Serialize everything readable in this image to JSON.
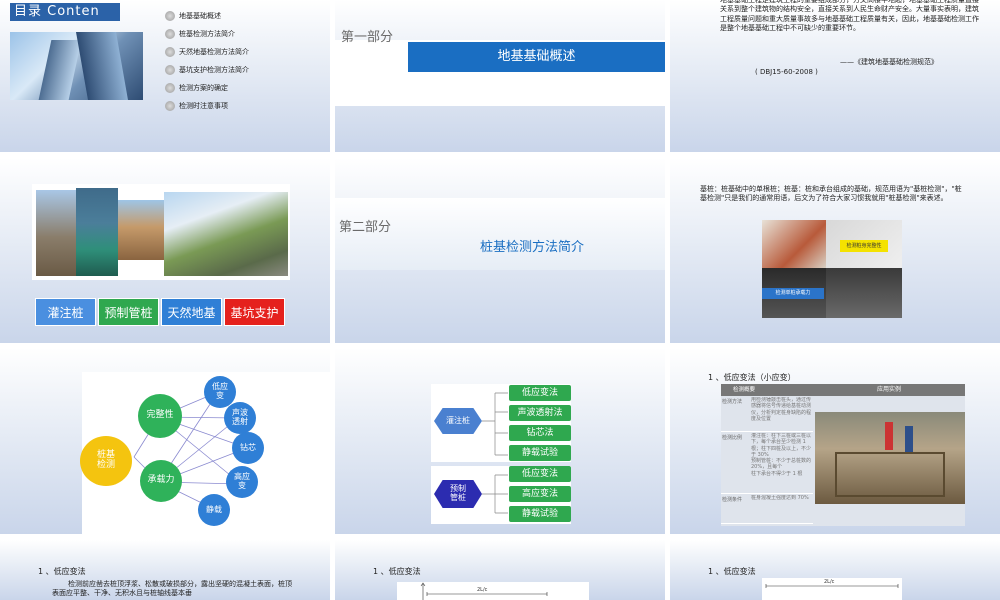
{
  "s1": {
    "title": "目录 Conten",
    "items": [
      "地基基础概述",
      "桩基检测方法简介",
      "天然地基检测方法简介",
      "基坑支护检测方法简介",
      "检测方案的确定",
      "检测时注意事项"
    ]
  },
  "s2": {
    "part": "第一部分",
    "title": "地基基础概述"
  },
  "s3": {
    "body": "地基基础工程是建筑工程的重要组成部分，方文高楼平地起，地基基础工程质量直接关系到整个建筑物的结构安全，直接关系到人民生命财产安全。大量事实表明，建筑工程质量问题和重大质量事故多与地基基础工程质量有关，因此，地基基础检测工作是整个地基基础工程中不可缺少的重要环节。",
    "source": "——《建筑地基基础检测规范》",
    "code": "( DBJ15-60-2008 )"
  },
  "s4": {
    "buttons": [
      "灌注桩",
      "预制管桩",
      "天然地基",
      "基坑支护"
    ],
    "colors": [
      "#4a8fe0",
      "#2fa84f",
      "#2f7fd6",
      "#e5211d"
    ]
  },
  "s5": {
    "part": "第二部分",
    "title": "桩基检测方法简介"
  },
  "s6": {
    "body": "基桩：桩基础中的单根桩；桩基：桩和承台组成的基础，规范用语为\"基桩检测\"，\"桩基检测\"只是我们的通常用语，后文为了符合大家习惯我就用\"桩基检测\"来表述。",
    "tag1": "检测桩身完整性",
    "tag2": "检测单桩承载力"
  },
  "s7": {
    "center": "桩基\n检测",
    "a": "完整性",
    "b": "承载力",
    "leaves": [
      "低应\n变",
      "声波\n透射",
      "钻芯",
      "高应\n变",
      "静载"
    ]
  },
  "s8": {
    "g1": "灌注桩",
    "g1_items": [
      "低应变法",
      "声波透射法",
      "钻芯法",
      "静载试验"
    ],
    "g2": "预制\n管桩",
    "g2_items": [
      "低应变法",
      "高应变法",
      "静载试验"
    ]
  },
  "s9": {
    "heading": "1 、低应变法（小应变）",
    "th": [
      "检测概要",
      "",
      "应用实例"
    ],
    "rows": [
      [
        "检测方法",
        "用检测锤敲击桩头，通过传感器将信号传递给基桩动测仪，分析判定桩身缺陷的程度及位置"
      ],
      [
        "检测比例",
        "灌注桩：柱下三桩或三桩以下，每个承台至少检测 1 根；柱下四桩及以上，不少于 30%\n预制管桩：不少于总桩数的 20%，且每个\n柱下承台不得少于 1 根"
      ],
      [
        "检测条件",
        "桩身混凝土强度达到 70%"
      ]
    ]
  },
  "s10": {
    "heading": "1 、低应变法",
    "body": "检测前应凿去桩顶浮浆、松散或破损部分，露出坚硬的混凝土表面，桩顶表面应平整、干净、无积水且与桩轴线基本垂"
  },
  "s11": {
    "heading": "1 、低应变法",
    "label": "2L/c"
  },
  "s12": {
    "heading": "1 、低应变法",
    "label": "2L/c"
  }
}
